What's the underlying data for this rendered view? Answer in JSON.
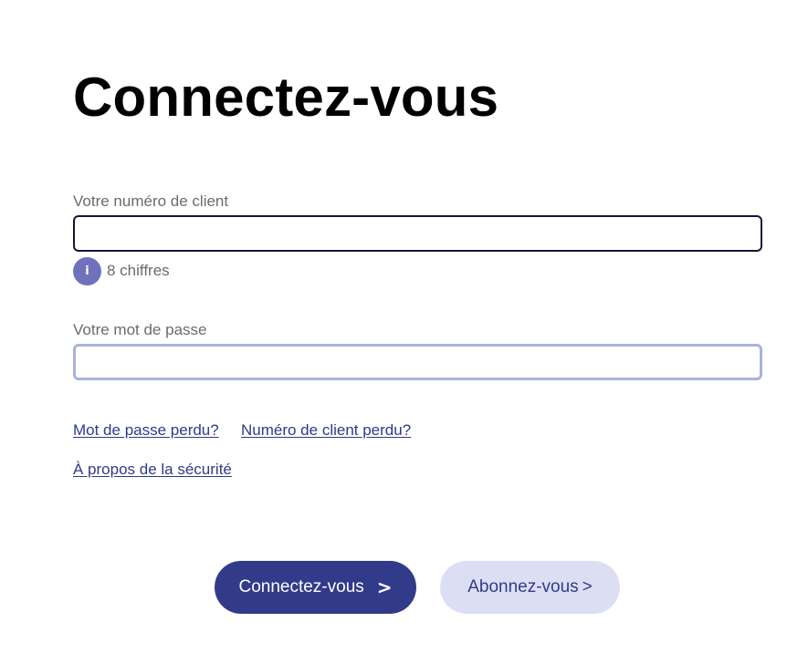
{
  "title": "Connectez-vous",
  "client_field": {
    "label": "Votre numéro de client",
    "value": "",
    "hint_icon": "info-icon",
    "hint": "8 chiffres"
  },
  "password_field": {
    "label": "Votre mot de passe",
    "value": ""
  },
  "links": {
    "password_lost": "Mot de passe perdu?",
    "client_number_lost": "Numéro de client perdu?",
    "security": "À propos de la sécurité"
  },
  "buttons": {
    "login_label": "Connectez-vous",
    "login_chevron": ">",
    "subscribe_label": "Abonnez-vous",
    "subscribe_chevron": ">"
  },
  "colors": {
    "primary": "#323b8a",
    "primary_light": "#dcdff3",
    "focus_border": "#15153a",
    "input_border": "#a9b3dc",
    "info_icon": "#6f72bb",
    "label_text": "#6b6b6b"
  }
}
